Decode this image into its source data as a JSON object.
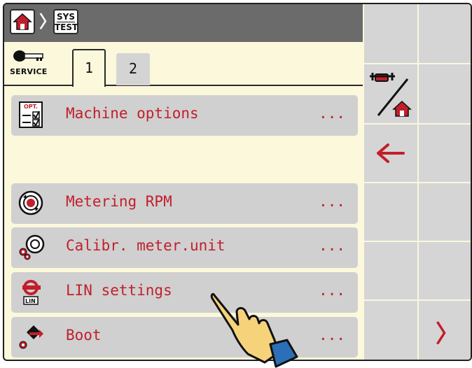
{
  "header": {
    "home_icon": "home-icon",
    "separator": "〉",
    "systest_line1": "SYS",
    "systest_line2": "TEST"
  },
  "service": {
    "label": "SERVICE",
    "icon": "key-icon"
  },
  "tabs": [
    {
      "label": "1",
      "active": true
    },
    {
      "label": "2",
      "active": false
    }
  ],
  "menu": [
    {
      "label": "Machine options",
      "dots": "...",
      "icon": "opt-checklist-icon"
    },
    {
      "label": "Metering RPM",
      "dots": "...",
      "icon": "metering-rpm-icon"
    },
    {
      "label": "Calibr. meter.unit",
      "dots": "...",
      "icon": "calibration-icon"
    },
    {
      "label": "LIN settings",
      "dots": "...",
      "icon": "lin-icon"
    },
    {
      "label": "Boot",
      "dots": "...",
      "icon": "boot-icon"
    }
  ],
  "side_buttons": {
    "mode_switch_icon": "machine-home-switch-icon",
    "back_icon": "arrow-left-icon",
    "next_icon": "chevron-right-icon",
    "next_glyph": "〉"
  },
  "colors": {
    "background": "#fbf8dc",
    "header": "#6b6b6b",
    "row": "#d0d0d0",
    "text_red": "#c11f2b",
    "button_grey": "#d5d5d5"
  }
}
